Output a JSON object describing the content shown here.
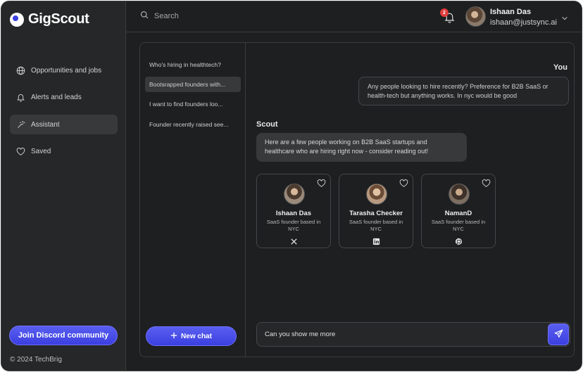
{
  "app": {
    "name": "GigScout"
  },
  "sidebar": {
    "items": [
      {
        "label": "Opportunities and jobs",
        "icon": "globe-icon"
      },
      {
        "label": "Alerts and leads",
        "icon": "bell-icon"
      },
      {
        "label": "Assistant",
        "icon": "sparkle-wand-icon",
        "active": true
      },
      {
        "label": "Saved",
        "icon": "heart-icon"
      }
    ],
    "discord_button": "Join Discord community",
    "copyright": "© 2024 TechBrig"
  },
  "topbar": {
    "search_placeholder": "Search",
    "notification_count": "2",
    "user": {
      "name": "Ishaan Das",
      "email": "ishaan@justsync.ai"
    }
  },
  "chat_history": {
    "items": [
      "Who's hiring in healthtech?",
      "Bootsrapped founders with...",
      "I want to find founders loo...",
      "Founder recently raised see..."
    ],
    "active_index": 1,
    "new_chat_label": "New chat"
  },
  "conversation": {
    "user_label": "You",
    "user_message": "Any people looking to hire recently? Preference for B2B SaaS or health-tech but anything works. In nyc would be good",
    "assistant_label": "Scout",
    "assistant_message": "Here are a few people working on B2B SaaS startups and healthcare who are hiring right now - consider reading out!",
    "cards": [
      {
        "name": "Ishaan Das",
        "desc": "SaaS founder based in NYC",
        "social": "x-icon"
      },
      {
        "name": "Tarasha Checker",
        "desc": "SaaS founder based in NYC",
        "social": "linkedin-icon"
      },
      {
        "name": "NamanD",
        "desc": "SaaS founder based in NYC",
        "social": "github-icon"
      }
    ]
  },
  "composer": {
    "value": "Can you show me more"
  },
  "colors": {
    "accent": "#4a4fe8",
    "background": "#1e1f20",
    "sidebar": "#262728",
    "badge": "#e03b3b"
  }
}
